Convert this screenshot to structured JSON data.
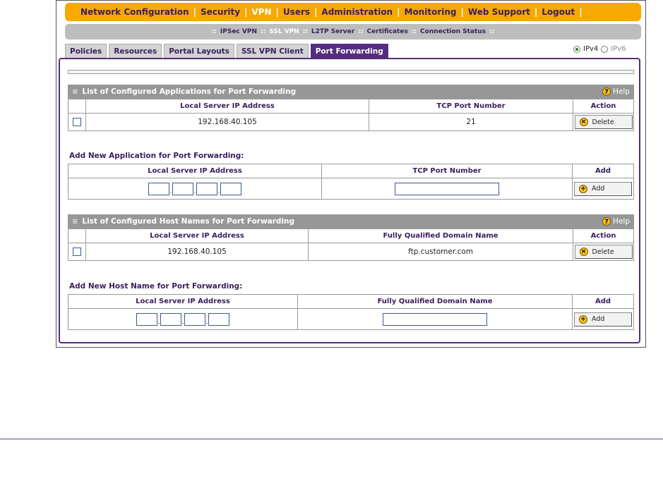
{
  "top_nav": {
    "items": [
      {
        "label": "Network Configuration",
        "active": false
      },
      {
        "label": "Security",
        "active": false
      },
      {
        "label": "VPN",
        "active": true
      },
      {
        "label": "Users",
        "active": false
      },
      {
        "label": "Administration",
        "active": false
      },
      {
        "label": "Monitoring",
        "active": false
      },
      {
        "label": "Web Support",
        "active": false
      },
      {
        "label": "Logout",
        "active": false
      }
    ]
  },
  "sub_nav": {
    "items": [
      {
        "label": "IPSec VPN",
        "active": false
      },
      {
        "label": "SSL VPN",
        "active": true
      },
      {
        "label": "L2TP Server",
        "active": false
      },
      {
        "label": "Certificates",
        "active": false
      },
      {
        "label": "Connection Status",
        "active": false
      }
    ]
  },
  "tabs": [
    {
      "label": "Policies",
      "active": false
    },
    {
      "label": "Resources",
      "active": false
    },
    {
      "label": "Portal Layouts",
      "active": false
    },
    {
      "label": "SSL VPN Client",
      "active": false
    },
    {
      "label": "Port Forwarding",
      "active": true
    }
  ],
  "ip_version": {
    "ipv4": "IPv4",
    "ipv6": "IPv6",
    "selected": "IPv4"
  },
  "apps_section": {
    "title": "List of Configured Applications for Port Forwarding",
    "help": "Help",
    "headers": {
      "ip": "Local Server IP Address",
      "port": "TCP Port Number",
      "action": "Action"
    },
    "rows": [
      {
        "ip": "192.168.40.105",
        "port": "21",
        "action": "Delete"
      }
    ]
  },
  "add_app": {
    "title": "Add New Application for Port Forwarding:",
    "headers": {
      "ip": "Local Server IP Address",
      "port": "TCP Port Number",
      "add": "Add"
    },
    "button": "Add"
  },
  "hosts_section": {
    "title": "List of Configured Host Names for Port Forwarding",
    "help": "Help",
    "headers": {
      "ip": "Local Server IP Address",
      "fqdn": "Fully Qualified Domain Name",
      "action": "Action"
    },
    "rows": [
      {
        "ip": "192.168.40.105",
        "fqdn": "ftp.customer.com",
        "action": "Delete"
      }
    ]
  },
  "add_host": {
    "title": "Add New Host Name for Port Forwarding:",
    "headers": {
      "ip": "Local Server IP Address",
      "fqdn": "Fully Qualified Domain Name",
      "add": "Add"
    },
    "button": "Add"
  },
  "colors": {
    "nav_orange": "#f7a900",
    "brand_purple": "#542d7f",
    "section_gray": "#979797",
    "subnav_gray": "#bdbdbd"
  },
  "icons": {
    "delete": "x-circle-icon",
    "add": "plus-circle-icon",
    "help": "question-circle-icon"
  }
}
